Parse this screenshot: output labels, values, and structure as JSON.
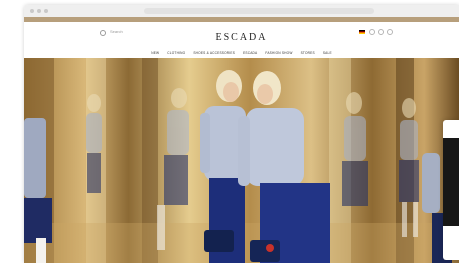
{
  "browser": {
    "controls": [
      "close",
      "minimize",
      "maximize"
    ]
  },
  "promo_bar": {
    "text": ""
  },
  "header": {
    "search_label": "Search",
    "logo": "ESCADA",
    "icons": [
      "flag-germany-icon",
      "account-icon",
      "wishlist-icon",
      "bag-icon"
    ]
  },
  "nav": {
    "items": [
      {
        "label": "NEW"
      },
      {
        "label": "CLOTHING"
      },
      {
        "label": "SHOES & ACCESSORIES"
      },
      {
        "label": "ESCADA"
      },
      {
        "label": "FASHION SHOW"
      },
      {
        "label": "STORES"
      },
      {
        "label": "SALE"
      }
    ]
  },
  "hero": {
    "description_colors": {
      "gold": "#c8a45e",
      "shirt": "#b9c2d6",
      "skirt": "#1e2f7a",
      "hair": "#efe3c4"
    }
  },
  "colors": {
    "accent": "#b79f7c",
    "text": "#222222"
  }
}
